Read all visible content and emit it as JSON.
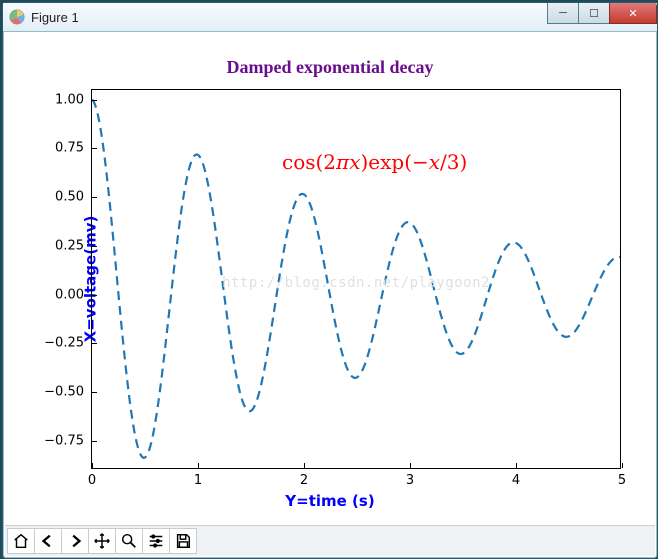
{
  "window": {
    "title": "Figure 1"
  },
  "win_buttons": {
    "minimize": "─",
    "maximize": "☐",
    "close": "✕"
  },
  "chart_data": {
    "type": "line",
    "title": "Damped exponential decay",
    "xlabel": "Y=time (s)",
    "ylabel": "X=voltage(mv)",
    "x_range": [
      0,
      5
    ],
    "y_range": [
      -0.9,
      1.05
    ],
    "x_ticks": [
      0,
      1,
      2,
      3,
      4,
      5
    ],
    "y_ticks": [
      -0.75,
      -0.5,
      -0.25,
      0.0,
      0.25,
      0.5,
      0.75,
      1.0
    ],
    "y_tick_labels": [
      "−0.75",
      "−0.50",
      "−0.25",
      "0.00",
      "0.25",
      "0.50",
      "0.75",
      "1.00"
    ],
    "line_style": "dashed",
    "line_color": "#1f77b4",
    "annotation": "cos(2πx)exp(−x/3)",
    "annotation_color": "#ff0000",
    "watermark": "http://blog.csdn.net/playgoon2",
    "series": [
      {
        "name": "cos(2*pi*x)*exp(-x/3)",
        "formula": "cos(2*pi*x)*exp(-x/3)",
        "x_sample": [
          0.0,
          0.25,
          0.5,
          0.75,
          1.0,
          1.25,
          1.5,
          1.75,
          2.0,
          2.25,
          2.5,
          2.75,
          3.0,
          3.25,
          3.5,
          3.75,
          4.0,
          4.25,
          4.5,
          4.75,
          5.0
        ],
        "y_sample": [
          1.0,
          0.0,
          -0.846,
          0.0,
          0.717,
          0.0,
          -0.607,
          0.0,
          0.513,
          0.0,
          -0.435,
          0.0,
          0.368,
          0.0,
          -0.311,
          0.0,
          0.264,
          0.0,
          -0.223,
          0.0,
          0.189
        ]
      }
    ]
  },
  "toolbar": {
    "items": [
      {
        "name": "home-icon",
        "label": "Home"
      },
      {
        "name": "back-icon",
        "label": "Back"
      },
      {
        "name": "forward-icon",
        "label": "Forward"
      },
      {
        "name": "pan-icon",
        "label": "Pan"
      },
      {
        "name": "zoom-icon",
        "label": "Zoom"
      },
      {
        "name": "subplots-icon",
        "label": "Configure subplots"
      },
      {
        "name": "save-icon",
        "label": "Save"
      }
    ]
  }
}
